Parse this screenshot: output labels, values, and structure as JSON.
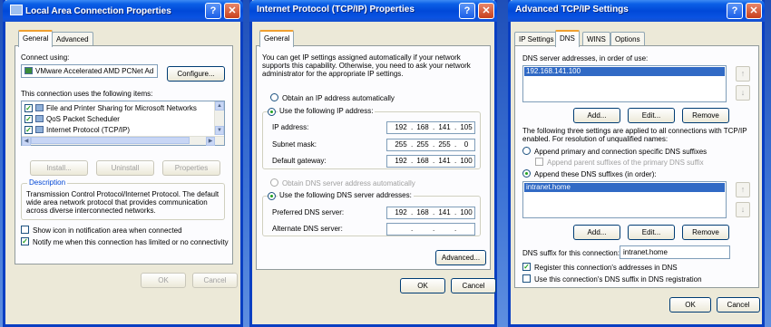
{
  "lan": {
    "title": "Local Area Connection Properties",
    "tabs": [
      "General",
      "Advanced"
    ],
    "connect_using_label": "Connect using:",
    "adapter": "VMware Accelerated AMD PCNet Ad",
    "configure_btn": "Configure...",
    "items_label": "This connection uses the following items:",
    "items": [
      "File and Printer Sharing for Microsoft Networks",
      "QoS Packet Scheduler",
      "Internet Protocol (TCP/IP)"
    ],
    "install_btn": "Install...",
    "uninstall_btn": "Uninstall",
    "properties_btn": "Properties",
    "description_title": "Description",
    "description_text": "Transmission Control Protocol/Internet Protocol. The default wide area network protocol that provides communication across diverse interconnected networks.",
    "show_icon_label": "Show icon in notification area when connected",
    "notify_label": "Notify me when this connection has limited or no connectivity",
    "ok_btn": "OK",
    "cancel_btn": "Cancel"
  },
  "tcpip": {
    "title": "Internet Protocol (TCP/IP) Properties",
    "tab": "General",
    "intro": "You can get IP settings assigned automatically if your network supports this capability. Otherwise, you need to ask your network administrator for the appropriate IP settings.",
    "obtain_ip_auto": "Obtain an IP address automatically",
    "use_following_ip": "Use the following IP address:",
    "ip_label": "IP address:",
    "ip": [
      "192",
      "168",
      "141",
      "105"
    ],
    "subnet_label": "Subnet mask:",
    "subnet": [
      "255",
      "255",
      "255",
      "0"
    ],
    "gateway_label": "Default gateway:",
    "gateway": [
      "192",
      "168",
      "141",
      "100"
    ],
    "obtain_dns_auto": "Obtain DNS server address automatically",
    "use_following_dns": "Use the following DNS server addresses:",
    "preferred_dns_label": "Preferred DNS server:",
    "preferred_dns": [
      "192",
      "168",
      "141",
      "100"
    ],
    "alternate_dns_label": "Alternate DNS server:",
    "advanced_btn": "Advanced...",
    "ok_btn": "OK",
    "cancel_btn": "Cancel"
  },
  "adv": {
    "title": "Advanced TCP/IP Settings",
    "tabs": [
      "IP Settings",
      "DNS",
      "WINS",
      "Options"
    ],
    "dns_servers_label": "DNS server addresses, in order of use:",
    "dns_server": "192.168.141.100",
    "add_btn": "Add...",
    "edit_btn": "Edit...",
    "remove_btn": "Remove",
    "resolution_text": "The following three settings are applied to all connections with TCP/IP enabled. For resolution of unqualified names:",
    "append_primary": "Append primary and connection specific DNS suffixes",
    "append_parent": "Append parent suffixes of the primary DNS suffix",
    "append_these": "Append these DNS suffixes (in order):",
    "suffix": "intranet.home",
    "dns_suffix_label": "DNS suffix for this connection:",
    "dns_suffix_value": "intranet.home",
    "register_label": "Register this connection's addresses in DNS",
    "use_suffix_label": "Use this connection's DNS suffix in DNS registration",
    "ok_btn": "OK",
    "cancel_btn": "Cancel"
  }
}
